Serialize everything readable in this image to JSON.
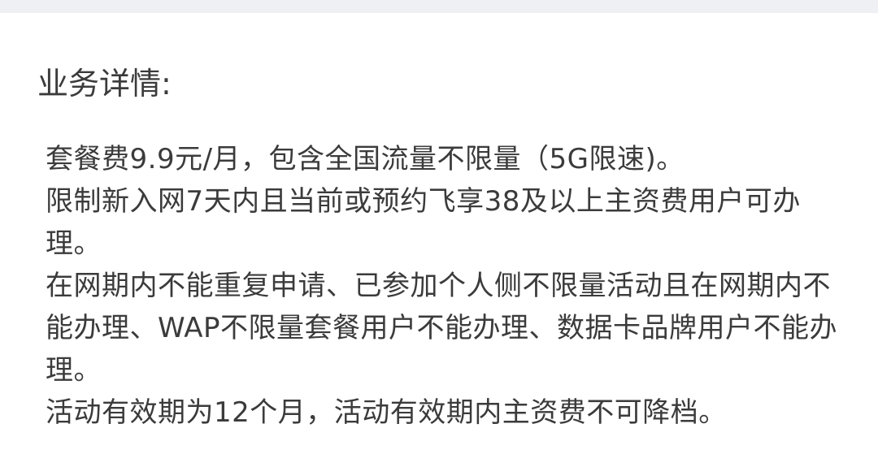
{
  "section": {
    "title": "业务详情:"
  },
  "details": [
    "套餐费9.9元/月，包含全国流量不限量（5G限速)。",
    "限制新入网7天内且当前或预约飞享38及以上主资费用户可办理。",
    "在网期内不能重复申请、已参加个人侧不限量活动且在网期内不能办理、WAP不限量套餐用户不能办理、数据卡品牌用户不能办理。",
    "活动有效期为12个月，活动有效期内主资费不可降档。"
  ]
}
